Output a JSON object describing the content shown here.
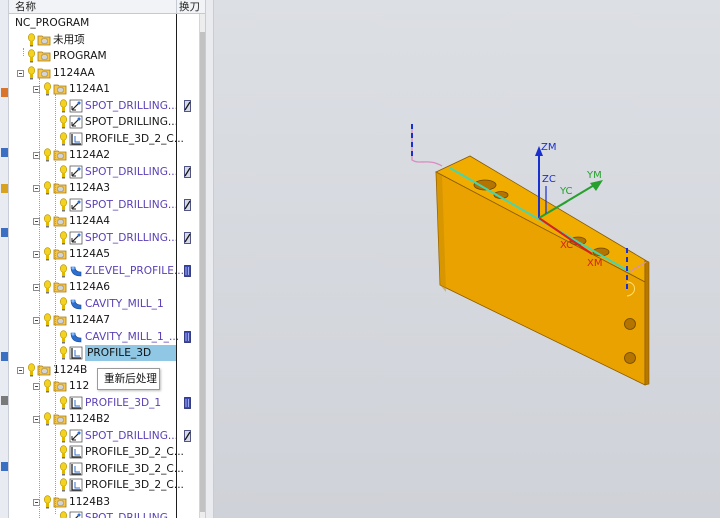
{
  "navigator": {
    "col_name": "名称",
    "col_tool": "换刀",
    "rows": [
      {
        "label": "NC_PROGRAM",
        "level": 0,
        "kind": "root",
        "color": "black"
      },
      {
        "label": "未用项",
        "level": 1,
        "kind": "group",
        "color": "black"
      },
      {
        "label": "PROGRAM",
        "level": 1,
        "kind": "program",
        "color": "black"
      },
      {
        "label": "1124AA",
        "level": 1,
        "kind": "program",
        "color": "black",
        "expanded": true
      },
      {
        "label": "1124A1",
        "level": 2,
        "kind": "program",
        "color": "black",
        "expanded": true
      },
      {
        "label": "SPOT_DRILLING...",
        "level": 3,
        "kind": "drill",
        "color": "purple",
        "tool": true
      },
      {
        "label": "SPOT_DRILLING...",
        "level": 3,
        "kind": "drill",
        "color": "black",
        "tool": false
      },
      {
        "label": "PROFILE_3D_2_C...",
        "level": 3,
        "kind": "profile",
        "color": "black",
        "tool": false
      },
      {
        "label": "1124A2",
        "level": 2,
        "kind": "program",
        "color": "black",
        "expanded": true
      },
      {
        "label": "SPOT_DRILLING...",
        "level": 3,
        "kind": "drill",
        "color": "purple",
        "tool": true
      },
      {
        "label": "1124A3",
        "level": 2,
        "kind": "program",
        "color": "black",
        "expanded": true
      },
      {
        "label": "SPOT_DRILLING...",
        "level": 3,
        "kind": "drill",
        "color": "purple",
        "tool": true
      },
      {
        "label": "1124A4",
        "level": 2,
        "kind": "program",
        "color": "black",
        "expanded": true
      },
      {
        "label": "SPOT_DRILLING...",
        "level": 3,
        "kind": "drill",
        "color": "purple",
        "tool": true
      },
      {
        "label": "1124A5",
        "level": 2,
        "kind": "program",
        "color": "black",
        "expanded": true
      },
      {
        "label": "ZLEVEL_PROFILE...",
        "level": 3,
        "kind": "mill",
        "color": "purple",
        "tool": true
      },
      {
        "label": "1124A6",
        "level": 2,
        "kind": "program",
        "color": "black",
        "expanded": true
      },
      {
        "label": "CAVITY_MILL_1",
        "level": 3,
        "kind": "mill",
        "color": "purple",
        "tool": false
      },
      {
        "label": "1124A7",
        "level": 2,
        "kind": "program",
        "color": "black",
        "expanded": true
      },
      {
        "label": "CAVITY_MILL_1_...",
        "level": 3,
        "kind": "mill",
        "color": "purple",
        "tool": true
      },
      {
        "label": "PROFILE_3D",
        "level": 3,
        "kind": "profile",
        "color": "black",
        "tool": false,
        "selected": true
      },
      {
        "label": "1124B",
        "level": 1,
        "kind": "program",
        "color": "black",
        "expanded": true
      },
      {
        "label": "112",
        "level": 2,
        "kind": "program",
        "color": "black",
        "expanded": true
      },
      {
        "label": "PROFILE_3D_1",
        "level": 3,
        "kind": "profile",
        "color": "purple",
        "tool": true
      },
      {
        "label": "1124B2",
        "level": 2,
        "kind": "program",
        "color": "black",
        "expanded": true
      },
      {
        "label": "SPOT_DRILLING...",
        "level": 3,
        "kind": "drill",
        "color": "purple",
        "tool": true
      },
      {
        "label": "PROFILE_3D_2_C...",
        "level": 3,
        "kind": "profile",
        "color": "black",
        "tool": false
      },
      {
        "label": "PROFILE_3D_2_C...",
        "level": 3,
        "kind": "profile",
        "color": "black",
        "tool": false
      },
      {
        "label": "PROFILE_3D_2_C...",
        "level": 3,
        "kind": "profile",
        "color": "black",
        "tool": false
      },
      {
        "label": "1124B3",
        "level": 2,
        "kind": "program",
        "color": "black",
        "expanded": true
      },
      {
        "label": "SPOT_DRILLING...",
        "level": 3,
        "kind": "drill",
        "color": "purple",
        "tool": false
      }
    ]
  },
  "tooltip": {
    "text": "重新后处理"
  },
  "viewport": {
    "axes": {
      "zm": "ZM",
      "zc": "ZC",
      "yc": "YC",
      "ym": "YM",
      "xc": "XC",
      "xm": "XM"
    }
  },
  "colors": {
    "part_top": "#f2b100",
    "part_front": "#e6a200",
    "part_side": "#b87800",
    "selected_row": "#8fc7e4",
    "purple_text": "#5a3fb5",
    "axis_blue": "#1a2fd0",
    "axis_green": "#27a02d",
    "axis_red": "#d82020"
  }
}
